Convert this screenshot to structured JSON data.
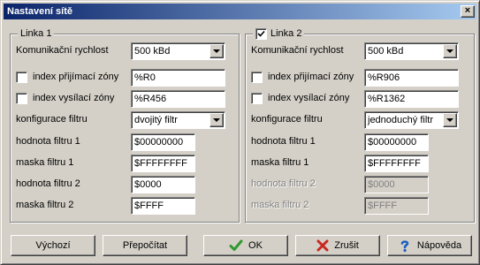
{
  "window": {
    "title": "Nastavení sítě",
    "close_label": "×"
  },
  "link1": {
    "legend": "Linka 1",
    "speed_label": "Komunikační rychlost",
    "speed_value": "500 kBd",
    "rx_label": "index přijímací zóny",
    "rx_value": "%R0",
    "tx_label": "index vysílací zóny",
    "tx_value": "%R456",
    "filter_cfg_label": "konfigurace filtru",
    "filter_cfg_value": "dvojitý filtr",
    "filter1_label": "hodnota filtru 1",
    "filter1_value": "$00000000",
    "mask1_label": "maska filtru 1",
    "mask1_value": "$FFFFFFFF",
    "filter2_label": "hodnota filtru 2",
    "filter2_value": "$0000",
    "mask2_label": "maska filtru 2",
    "mask2_value": "$FFFF"
  },
  "link2": {
    "legend": "Linka 2",
    "speed_label": "Komunikační rychlost",
    "speed_value": "500 kBd",
    "rx_label": "index přijímací zóny",
    "rx_value": "%R906",
    "tx_label": "index vysílací zóny",
    "tx_value": "%R1362",
    "filter_cfg_label": "konfigurace filtru",
    "filter_cfg_value": "jednoduchý filtr",
    "filter1_label": "hodnota filtru 1",
    "filter1_value": "$00000000",
    "mask1_label": "maska filtru 1",
    "mask1_value": "$FFFFFFFF",
    "filter2_label": "hodnota filtru 2",
    "filter2_value": "$0000",
    "mask2_label": "maska filtru 2",
    "mask2_value": "$FFFF"
  },
  "buttons": {
    "default_label": "Výchozí",
    "recalc_label": "Přepočítat",
    "ok_label": "OK",
    "cancel_label": "Zrušit",
    "help_label": "Nápověda"
  },
  "colors": {
    "title_gradient_start": "#0a246a",
    "title_gradient_end": "#a6caf0",
    "ok_check": "#2e9a2e",
    "cancel_x": "#c8281e",
    "help_mark": "#1f5fbf"
  },
  "icons": {
    "ok": "check-icon",
    "cancel": "x-icon",
    "help": "question-icon"
  }
}
